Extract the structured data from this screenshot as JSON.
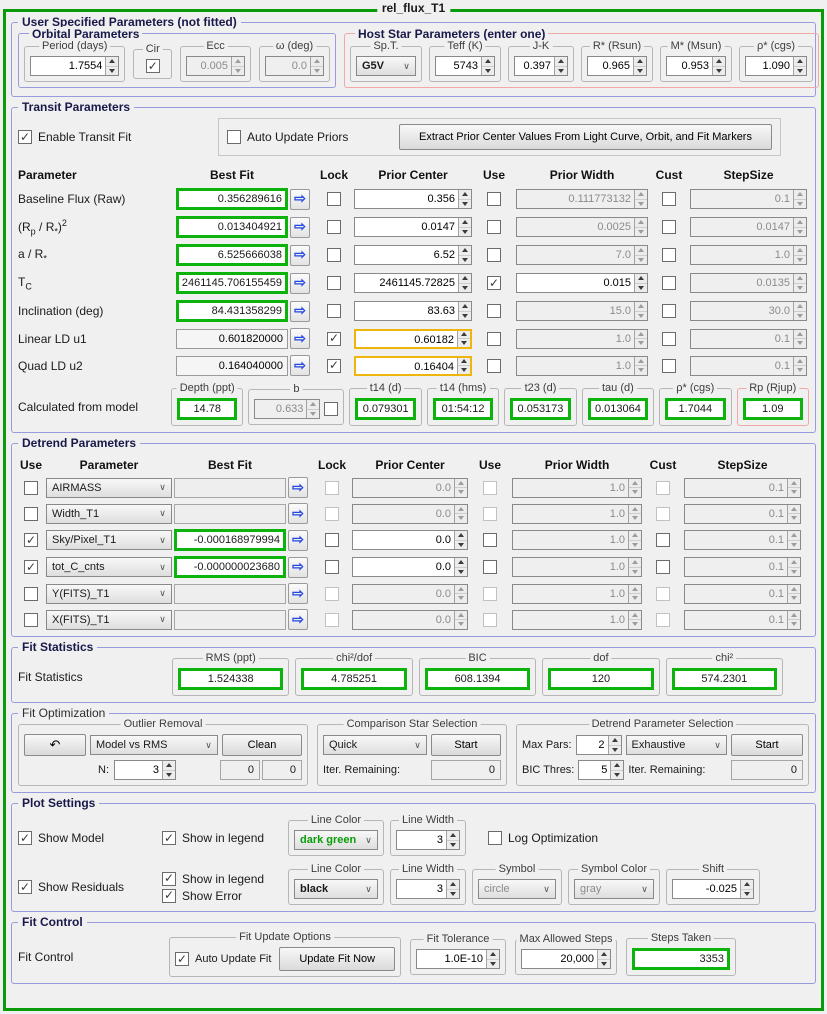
{
  "window": {
    "title": "rel_flux_T1"
  },
  "colors": {
    "outer_border": "#0a9b0a",
    "bestfit_border": "#0cb30c",
    "prior_locked_border": "#eeb60c",
    "section_border": "#9a9ade",
    "hoststar_border": "#f0a8a8",
    "dark_green_text": "#089d08"
  },
  "user_params": {
    "title": "User Specified Parameters (not fitted)",
    "orbital": {
      "title": "Orbital Parameters",
      "period_label": "Period (days)",
      "period": "1.7554",
      "cir_label": "Cir",
      "ecc_label": "Ecc",
      "ecc": "0.005",
      "omega_label": "ω (deg)",
      "omega": "0.0"
    },
    "host": {
      "title": "Host Star Parameters (enter one)",
      "spt_label": "Sp.T.",
      "spt": "G5V",
      "teff_label": "Teff (K)",
      "teff": "5743",
      "jk_label": "J-K",
      "jk": "0.397",
      "rstar_label": "R* (Rsun)",
      "rstar": "0.965",
      "mstar_label": "M* (Msun)",
      "mstar": "0.953",
      "rho_label": "ρ* (cgs)",
      "rho": "1.090"
    }
  },
  "transit": {
    "title": "Transit Parameters",
    "enable": "Enable Transit Fit",
    "auto_update": "Auto Update Priors",
    "extract": "Extract Prior Center Values From Light Curve, Orbit, and Fit Markers",
    "headers": {
      "parameter": "Parameter",
      "best_fit": "Best Fit",
      "lock": "Lock",
      "prior_center": "Prior Center",
      "use": "Use",
      "prior_width": "Prior Width",
      "cust": "Cust",
      "stepsize": "StepSize"
    },
    "rows": [
      {
        "label": "Baseline Flux (Raw)",
        "best_fit": "0.356289616",
        "prior_center": "0.356",
        "prior_width": "0.111773132",
        "stepsize": "0.1"
      },
      {
        "label": "(R<sub>p</sub> / R<sub>*</sub>)<sup>2</sup>",
        "best_fit": "0.013404921",
        "prior_center": "0.0147",
        "prior_width": "0.0025",
        "stepsize": "0.0147"
      },
      {
        "label": "a / R<sub>*</sub>",
        "best_fit": "6.525666038",
        "prior_center": "6.52",
        "prior_width": "7.0",
        "stepsize": "1.0"
      },
      {
        "label": "T<sub>C</sub>",
        "best_fit": "2461145.706155459",
        "prior_center": "2461145.72825",
        "prior_width": "0.015",
        "stepsize": "0.0135"
      },
      {
        "label": "Inclination (deg)",
        "best_fit": "84.431358299",
        "prior_center": "83.63",
        "prior_width": "15.0",
        "stepsize": "30.0"
      },
      {
        "label": "Linear LD u1",
        "best_fit": "0.601820000",
        "prior_center": "0.60182",
        "prior_width": "1.0",
        "stepsize": "0.1"
      },
      {
        "label": "Quad LD u2",
        "best_fit": "0.164040000",
        "prior_center": "0.16404",
        "prior_width": "1.0",
        "stepsize": "0.1"
      }
    ],
    "calculated": {
      "label": "Calculated from model",
      "depth_label": "Depth (ppt)",
      "depth": "14.78",
      "b_label": "b",
      "b": "0.633",
      "t14d_label": "t14 (d)",
      "t14d": "0.079301",
      "t14hms_label": "t14 (hms)",
      "t14hms": "01:54:12",
      "t23_label": "t23 (d)",
      "t23": "0.053173",
      "tau_label": "tau (d)",
      "tau": "0.013064",
      "rho_label": "ρ* (cgs)",
      "rho": "1.7044",
      "rp_label": "Rp (Rjup)",
      "rp": "1.09"
    }
  },
  "detrend": {
    "title": "Detrend Parameters",
    "headers": {
      "use": "Use",
      "parameter": "Parameter",
      "best_fit": "Best Fit",
      "lock": "Lock",
      "prior_center": "Prior Center",
      "use2": "Use",
      "prior_width": "Prior Width",
      "cust": "Cust",
      "stepsize": "StepSize"
    },
    "rows": [
      {
        "param": "AIRMASS",
        "best_fit": "",
        "prior_center": "0.0",
        "prior_width": "1.0",
        "stepsize": "0.1"
      },
      {
        "param": "Width_T1",
        "best_fit": "",
        "prior_center": "0.0",
        "prior_width": "1.0",
        "stepsize": "0.1"
      },
      {
        "param": "Sky/Pixel_T1",
        "best_fit": "-0.000168979994",
        "prior_center": "0.0",
        "prior_width": "1.0",
        "stepsize": "0.1"
      },
      {
        "param": "tot_C_cnts",
        "best_fit": "-0.000000023680",
        "prior_center": "0.0",
        "prior_width": "1.0",
        "stepsize": "0.1"
      },
      {
        "param": "Y(FITS)_T1",
        "best_fit": "",
        "prior_center": "0.0",
        "prior_width": "1.0",
        "stepsize": "0.1"
      },
      {
        "param": "X(FITS)_T1",
        "best_fit": "",
        "prior_center": "0.0",
        "prior_width": "1.0",
        "stepsize": "0.1"
      }
    ]
  },
  "stats": {
    "title": "Fit Statistics",
    "label": "Fit Statistics",
    "rms_label": "RMS (ppt)",
    "rms": "1.524338",
    "chi2dof_label": "chi²/dof",
    "chi2dof": "4.785251",
    "bic_label": "BIC",
    "bic": "608.1394",
    "dof_label": "dof",
    "dof": "120",
    "chi2_label": "chi²",
    "chi2": "574.2301"
  },
  "optim": {
    "title": "Fit Optimization",
    "outlier": {
      "title": "Outlier Removal",
      "undo_icon": "↶",
      "method": "Model vs RMS",
      "clean": "Clean",
      "n_label": "N:",
      "n": "3",
      "count1": "0",
      "count2": "0"
    },
    "comp": {
      "title": "Comparison Star Selection",
      "mode": "Quick",
      "start": "Start",
      "iter_label": "Iter. Remaining:",
      "iter": "0"
    },
    "detrend_sel": {
      "title": "Detrend Parameter Selection",
      "max_pars_label": "Max Pars:",
      "max_pars": "2",
      "method": "Exhaustive",
      "start": "Start",
      "bic_label": "BIC Thres:",
      "bic": "5",
      "iter_label": "Iter. Remaining:",
      "iter": "0"
    }
  },
  "plot": {
    "title": "Plot Settings",
    "model": {
      "show": "Show Model",
      "legend": "Show in legend",
      "line_color_label": "Line Color",
      "line_color": "dark green",
      "line_width_label": "Line Width",
      "line_width": "3",
      "log_opt": "Log Optimization"
    },
    "residuals": {
      "show": "Show Residuals",
      "legend": "Show in legend",
      "error": "Show Error",
      "line_color_label": "Line Color",
      "line_color": "black",
      "line_width_label": "Line Width",
      "line_width": "3",
      "symbol_label": "Symbol",
      "symbol": "circle",
      "symbol_color_label": "Symbol Color",
      "symbol_color": "gray",
      "shift_label": "Shift",
      "shift": "-0.025"
    }
  },
  "control": {
    "title": "Fit Control",
    "label": "Fit Control",
    "update": {
      "title": "Fit Update Options",
      "auto": "Auto Update Fit",
      "now": "Update Fit Now"
    },
    "tolerance_label": "Fit Tolerance",
    "tolerance": "1.0E-10",
    "max_steps_label": "Max Allowed Steps",
    "max_steps": "20,000",
    "steps_label": "Steps Taken",
    "steps": "3353"
  }
}
